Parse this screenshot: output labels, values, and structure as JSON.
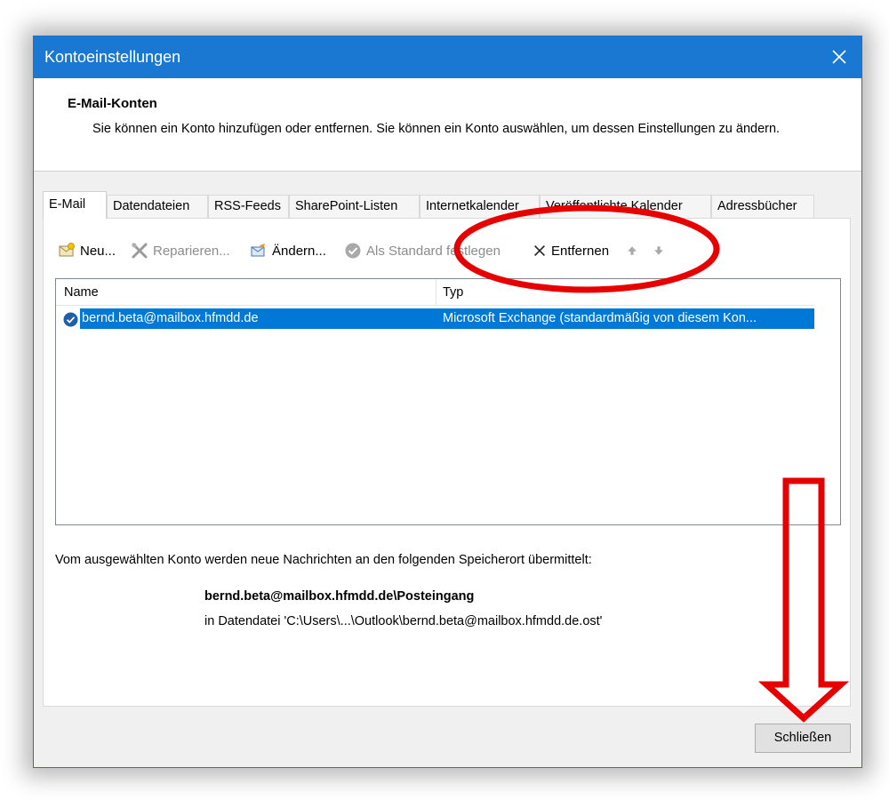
{
  "window": {
    "title": "Kontoeinstellungen"
  },
  "header": {
    "title": "E-Mail-Konten",
    "description": "Sie können ein Konto hinzufügen oder entfernen. Sie können ein Konto auswählen, um dessen Einstellungen zu ändern."
  },
  "tabs": [
    {
      "label": "E-Mail",
      "active": true
    },
    {
      "label": "Datendateien"
    },
    {
      "label": "RSS-Feeds"
    },
    {
      "label": "SharePoint-Listen"
    },
    {
      "label": "Internetkalender"
    },
    {
      "label": "Veröffentlichte Kalender"
    },
    {
      "label": "Adressbücher"
    }
  ],
  "toolbar": {
    "new_label": "Neu...",
    "repair_label": "Reparieren...",
    "change_label": "Ändern...",
    "default_label": "Als Standard festlegen",
    "remove_label": "Entfernen"
  },
  "list": {
    "columns": [
      "Name",
      "Typ"
    ],
    "rows": [
      {
        "name": "bernd.beta@mailbox.hfmdd.de",
        "type": "Microsoft Exchange (standardmäßig von diesem Kon..."
      }
    ]
  },
  "delivery": {
    "text": "Vom ausgewählten Konto werden neue Nachrichten an den folgenden Speicherort übermittelt:",
    "folder": "bernd.beta@mailbox.hfmdd.de\\Posteingang",
    "file": "in Datendatei 'C:\\Users\\...\\Outlook\\bernd.beta@mailbox.hfmdd.de.ost'"
  },
  "footer": {
    "close_label": "Schließen"
  },
  "colors": {
    "titlebar": "#1a78d2",
    "selection": "#0078d7",
    "annotation": "#e60000"
  }
}
